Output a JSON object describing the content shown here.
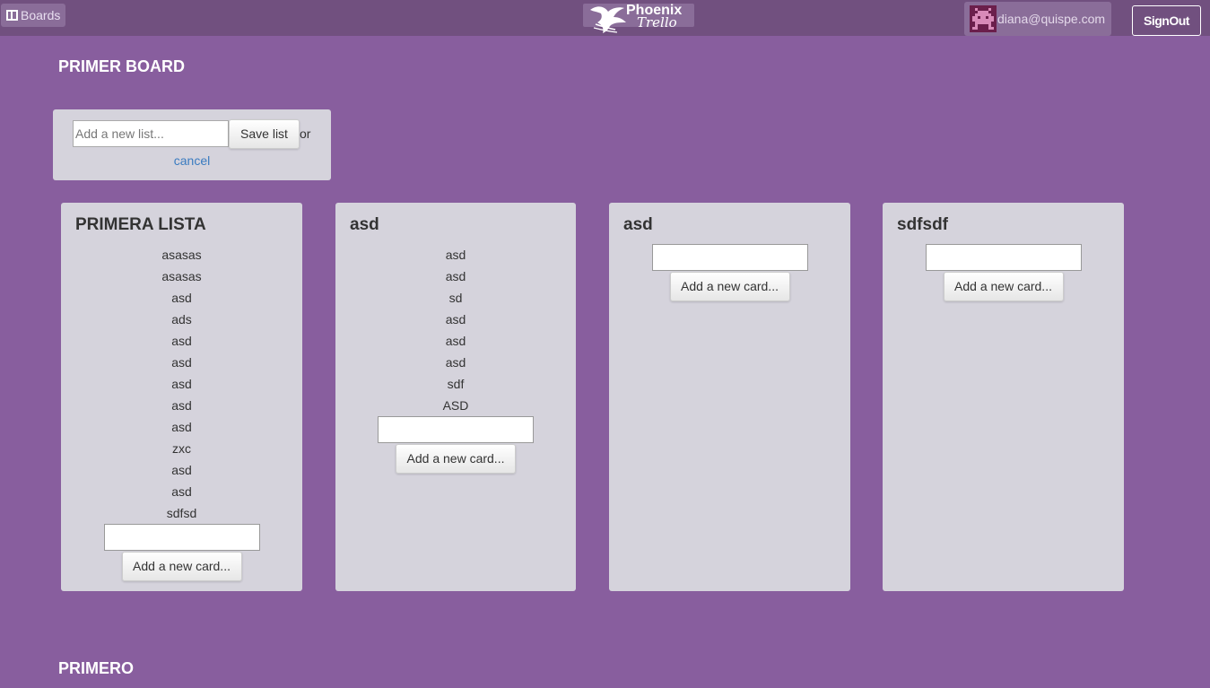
{
  "header": {
    "boards_label": "Boards",
    "logo_word1": "Phoenix",
    "logo_word2": "Trello",
    "user_email": "diana@quispe.com",
    "signout_label": "SignOut"
  },
  "board": {
    "title": "PRIMER BOARD"
  },
  "new_list": {
    "placeholder": "Add a new list...",
    "save_label": "Save list",
    "or_label": "or",
    "cancel_label": "cancel"
  },
  "lists": [
    {
      "title": "PRIMERA LISTA",
      "cards": [
        "asasas",
        "asasas",
        "asd",
        "ads",
        "asd",
        "asd",
        "asd",
        "asd",
        "asd",
        "zxc",
        "asd",
        "asd",
        "sdfsd"
      ],
      "add_card_label": "Add a new card..."
    },
    {
      "title": "asd",
      "cards": [
        "asd",
        "asd",
        "sd",
        "asd",
        "asd",
        "asd",
        "sdf",
        "ASD"
      ],
      "add_card_label": "Add a new card..."
    },
    {
      "title": "asd",
      "cards": [],
      "add_card_label": "Add a new card..."
    },
    {
      "title": "sdfsdf",
      "cards": [],
      "add_card_label": "Add a new card..."
    }
  ],
  "next_board": {
    "title": "PRIMERO"
  },
  "colors": {
    "background": "#885e9e",
    "topbar": "#71507f",
    "list_bg": "#d5d3dc",
    "link": "#3a7bc0"
  },
  "icons": [
    "boards-icon",
    "phoenix-logo-icon",
    "avatar-icon"
  ]
}
